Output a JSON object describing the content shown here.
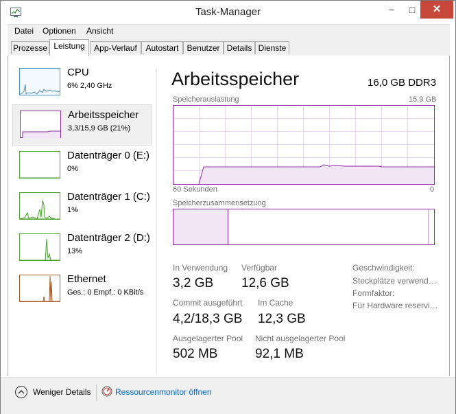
{
  "window": {
    "title": "Task-Manager"
  },
  "window_buttons": {
    "minimize": "−",
    "maximize": "□",
    "close": "✕"
  },
  "menu": [
    "Datei",
    "Optionen",
    "Ansicht"
  ],
  "tabs": [
    "Prozesse",
    "Leistung",
    "App-Verlauf",
    "Autostart",
    "Benutzer",
    "Details",
    "Dienste"
  ],
  "active_tab": "Leistung",
  "sidebar": [
    {
      "title": "CPU",
      "sub": "6%  2,40 GHz",
      "color": "#4a90c8"
    },
    {
      "title": "Arbeitsspeicher",
      "sub": "3,3/15,9 GB (21%)",
      "color": "#8b2aa3"
    },
    {
      "title": "Datenträger 0 (E:)",
      "sub": "0%",
      "color": "#4aa02c"
    },
    {
      "title": "Datenträger 1 (C:)",
      "sub": "1%",
      "color": "#4aa02c"
    },
    {
      "title": "Datenträger 2 (D:)",
      "sub": "13%",
      "color": "#4aa02c"
    },
    {
      "title": "Ethernet",
      "sub": "Ges.: 0  Empf.: 0 KBit/s",
      "color": "#a7561a"
    }
  ],
  "main": {
    "title": "Arbeitsspeicher",
    "spec": "16,0 GB DDR3",
    "usage_label": "Speicherauslastung",
    "usage_max": "15,9 GB",
    "time_left": "60 Sekunden",
    "time_right": "0",
    "composition_label": "Speicherzusammensetzung",
    "usage_fraction": 0.21,
    "accent": "#8b2aa3"
  },
  "stats": {
    "in_use_label": "In Verwendung",
    "in_use": "3,2 GB",
    "available_label": "Verfügbar",
    "available": "12,6 GB",
    "commit_label": "Commit ausgeführt",
    "commit": "4,2/18,3 GB",
    "cached_label": "Im Cache",
    "cached": "12,3 GB",
    "paged_label": "Ausgelagerter Pool",
    "paged": "502 MB",
    "nonpaged_label": "Nicht ausgelagerter Pool",
    "nonpaged": "92,1 MB"
  },
  "properties": [
    "Geschwindigkeit:",
    "Steckplätze verwend…",
    "Formfaktor:",
    "Für Hardware reservi…"
  ],
  "footer": {
    "fewer_details": "Weniger Details",
    "resource_monitor": "Ressourcenmonitor öffnen"
  }
}
